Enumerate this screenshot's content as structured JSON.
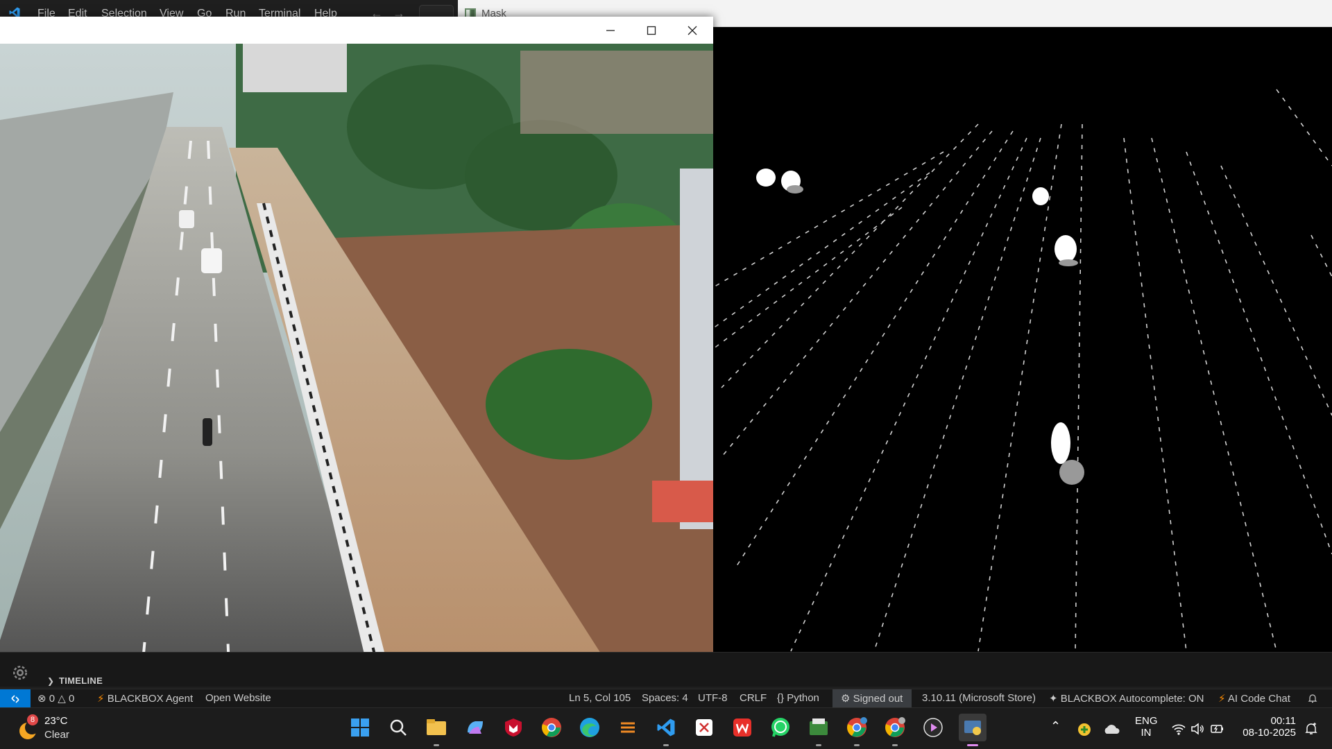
{
  "vscode": {
    "menu": [
      "File",
      "Edit",
      "Selection",
      "View",
      "Go",
      "Run",
      "Terminal",
      "Help"
    ],
    "panel": {
      "timeline_label": "TIMELINE"
    }
  },
  "mask_window": {
    "title": "Mask"
  },
  "status_bar": {
    "errors": "0",
    "warnings": "0",
    "blackbox_agent": "BLACKBOX Agent",
    "open_website": "Open Website",
    "cursor_position": "Ln 5, Col 105",
    "indentation": "Spaces: 4",
    "encoding": "UTF-8",
    "line_ending": "CRLF",
    "language": "Python",
    "account": "Signed out",
    "interpreter": "3.10.11 (Microsoft Store)",
    "autocomplete": "BLACKBOX Autocomplete: ON",
    "ai_chat": "AI Code Chat"
  },
  "taskbar": {
    "weather": {
      "temperature": "23°C",
      "condition": "Clear",
      "badge": "8"
    },
    "language": {
      "line1": "ENG",
      "line2": "IN"
    },
    "time": "00:11",
    "date": "08-10-2025",
    "apps": [
      "start-icon",
      "search-icon",
      "file-explorer-icon",
      "copilot-icon",
      "mcafee-icon",
      "chrome-icon",
      "edge-icon",
      "orange-app-icon",
      "vscode-icon",
      "snipping-icon",
      "wps-icon",
      "whatsapp-icon",
      "python-idle-icon",
      "chrome-profile-icon",
      "chrome-profile-2-icon",
      "media-player-icon",
      "python-app-icon"
    ]
  },
  "colors": {
    "vscode_blue": "#0078d4",
    "titlebar_light": "#f3f3f3",
    "background_dark": "#1f1f1f"
  }
}
